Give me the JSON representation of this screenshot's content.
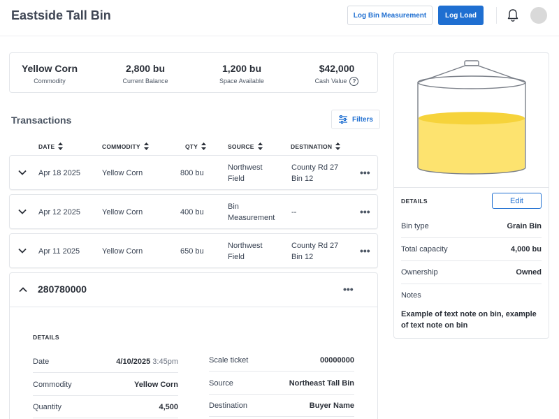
{
  "header": {
    "title": "Eastside Tall Bin",
    "log_measurement_label": "Log Bin Measurement",
    "log_load_label": "Log Load",
    "accent_color": "#1f6fd1"
  },
  "summary": [
    {
      "value": "Yellow Corn",
      "label": "Commodity"
    },
    {
      "value": "2,800 bu",
      "label": "Current Balance"
    },
    {
      "value": "1,200 bu",
      "label": "Space Available"
    },
    {
      "value": "$42,000",
      "label": "Cash Value"
    }
  ],
  "transactions": {
    "title": "Transactions",
    "filters_label": "Filters",
    "columns": [
      "DATE",
      "COMMODITY",
      "QTY",
      "SOURCE",
      "DESTINATION"
    ],
    "rows": [
      {
        "date": "Apr 18 2025",
        "commodity": "Yellow Corn",
        "qty": "800 bu",
        "source_1": "Northwest",
        "source_2": "Field",
        "dest_1": "County Rd 27",
        "dest_2": "Bin 12"
      },
      {
        "date": "Apr 12 2025",
        "commodity": "Yellow Corn",
        "qty": "400 bu",
        "source_1": "Bin",
        "source_2": "Measurement",
        "dest_1": "--",
        "dest_2": ""
      },
      {
        "date": "Apr 11 2025",
        "commodity": "Yellow Corn",
        "qty": "650 bu",
        "source_1": "Northwest",
        "source_2": "Field",
        "dest_1": "County Rd 27",
        "dest_2": "Bin 12"
      }
    ],
    "more_glyph": "•••"
  },
  "expanded": {
    "id": "280780000",
    "details_label": "DETAILS",
    "left": [
      {
        "key": "Date",
        "value": "4/10/2025",
        "time": "3:45pm"
      },
      {
        "key": "Commodity",
        "value": "Yellow Corn"
      },
      {
        "key": "Quantity",
        "value": "4,500"
      }
    ],
    "right": [
      {
        "key": "Scale ticket",
        "value": "00000000"
      },
      {
        "key": "Source",
        "value": "Northeast Tall Bin"
      },
      {
        "key": "Destination",
        "value": "Buyer Name"
      }
    ]
  },
  "bin": {
    "fill_level": 0.58,
    "fill_color": "#fde36f",
    "details_label": "DETAILS",
    "edit_label": "Edit",
    "props": [
      {
        "key": "Bin type",
        "value": "Grain Bin"
      },
      {
        "key": "Total capacity",
        "value": "4,000 bu"
      },
      {
        "key": "Ownership",
        "value": "Owned"
      }
    ],
    "notes_label": "Notes",
    "notes_text": "Example of text note on bin, example of text note on bin"
  }
}
